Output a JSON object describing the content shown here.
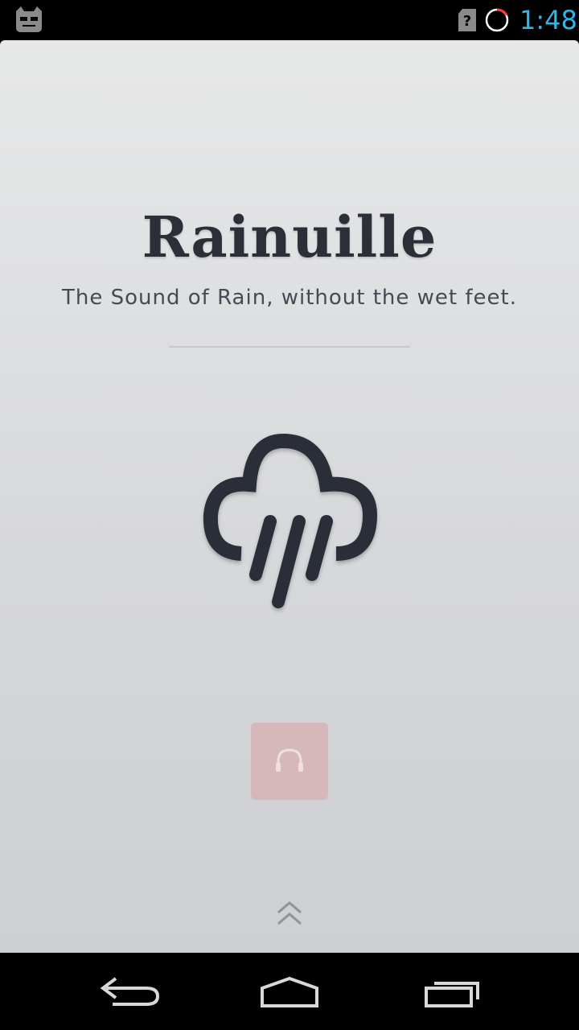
{
  "status_bar": {
    "time": "1:48",
    "time_color": "#33b5e5",
    "icons": [
      "cyanogenmod-android-icon",
      "sim-unknown-icon",
      "sync-progress-icon"
    ]
  },
  "app": {
    "title": "Rainuille",
    "subtitle": "The Sound of Rain, without the wet feet.",
    "main_icon": "rain-cloud-icon",
    "play_button_icon": "headphones-icon",
    "play_button_color": "#d6b8bb",
    "expand_icon": "double-chevron-up-icon",
    "text_color": "#2b2f37"
  },
  "nav_bar": {
    "buttons": [
      "back",
      "home",
      "recent-apps"
    ]
  }
}
